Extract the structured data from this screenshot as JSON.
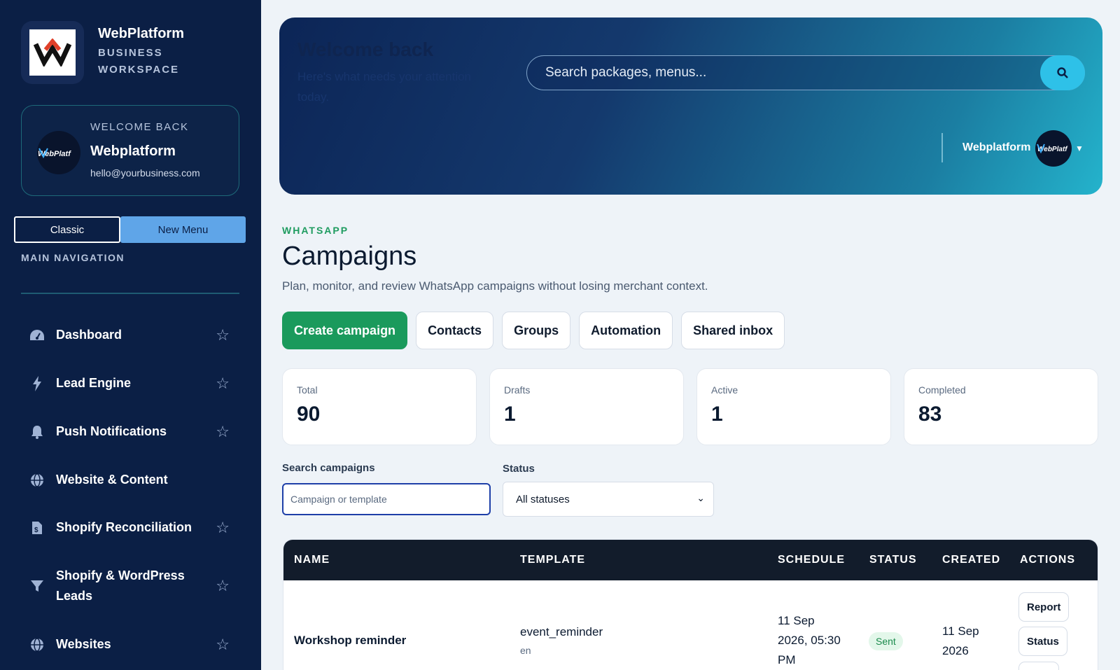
{
  "brand": {
    "name": "WebPlatform",
    "subtitle": "BUSINESS WORKSPACE"
  },
  "welcome_card": {
    "label": "WELCOME BACK",
    "name": "Webplatform",
    "email": "hello@yourbusiness.com",
    "avatar_text": "WebPlatf"
  },
  "menu_toggle": {
    "classic": "Classic",
    "new_menu": "New Menu"
  },
  "sidebar": {
    "section_label": "MAIN NAVIGATION",
    "items": [
      {
        "label": "Dashboard",
        "icon": "gauge-icon",
        "starred": true
      },
      {
        "label": "Lead Engine",
        "icon": "bolt-icon",
        "starred": true
      },
      {
        "label": "Push Notifications",
        "icon": "bell-icon",
        "starred": true
      },
      {
        "label": "Website & Content",
        "icon": "globe-icon",
        "starred": false
      },
      {
        "label": "Shopify Reconciliation",
        "icon": "file-dollar-icon",
        "starred": true
      },
      {
        "label": "Shopify & WordPress Leads",
        "icon": "filter-icon",
        "starred": true
      },
      {
        "label": "Websites",
        "icon": "globe-icon",
        "starred": true
      }
    ]
  },
  "hero": {
    "title": "Welcome back",
    "subtitle": "Here's what needs your attention today.",
    "search_placeholder": "Search packages, menus...",
    "user_name": "Webplatform",
    "avatar_text": "WebPlatf"
  },
  "page": {
    "eyebrow": "WHATSAPP",
    "title": "Campaigns",
    "description": "Plan, monitor, and review WhatsApp campaigns without losing merchant context."
  },
  "actions": {
    "create": "Create campaign",
    "contacts": "Contacts",
    "groups": "Groups",
    "automation": "Automation",
    "shared_inbox": "Shared inbox"
  },
  "stats": [
    {
      "label": "Total",
      "value": "90"
    },
    {
      "label": "Drafts",
      "value": "1"
    },
    {
      "label": "Active",
      "value": "1"
    },
    {
      "label": "Completed",
      "value": "83"
    }
  ],
  "filters": {
    "search_label": "Search campaigns",
    "search_placeholder": "Campaign or template",
    "status_label": "Status",
    "status_value": "All statuses"
  },
  "table": {
    "columns": [
      "NAME",
      "TEMPLATE",
      "SCHEDULE",
      "STATUS",
      "CREATED",
      "ACTIONS"
    ],
    "rows": [
      {
        "name": "Workshop reminder",
        "template": "event_reminder",
        "language": "en",
        "schedule_line1": "11 Sep",
        "schedule_line2": "2026, 05:30",
        "schedule_line3": "PM",
        "status": "Sent",
        "created_line1": "11 Sep",
        "created_line2": "2026",
        "actions": [
          "Report",
          "Status"
        ]
      }
    ]
  },
  "colors": {
    "sidebar_bg": "#0b1f45",
    "primary_green": "#1a9a5c",
    "accent_cyan": "#2ec1e8",
    "table_header": "#121c2b"
  }
}
